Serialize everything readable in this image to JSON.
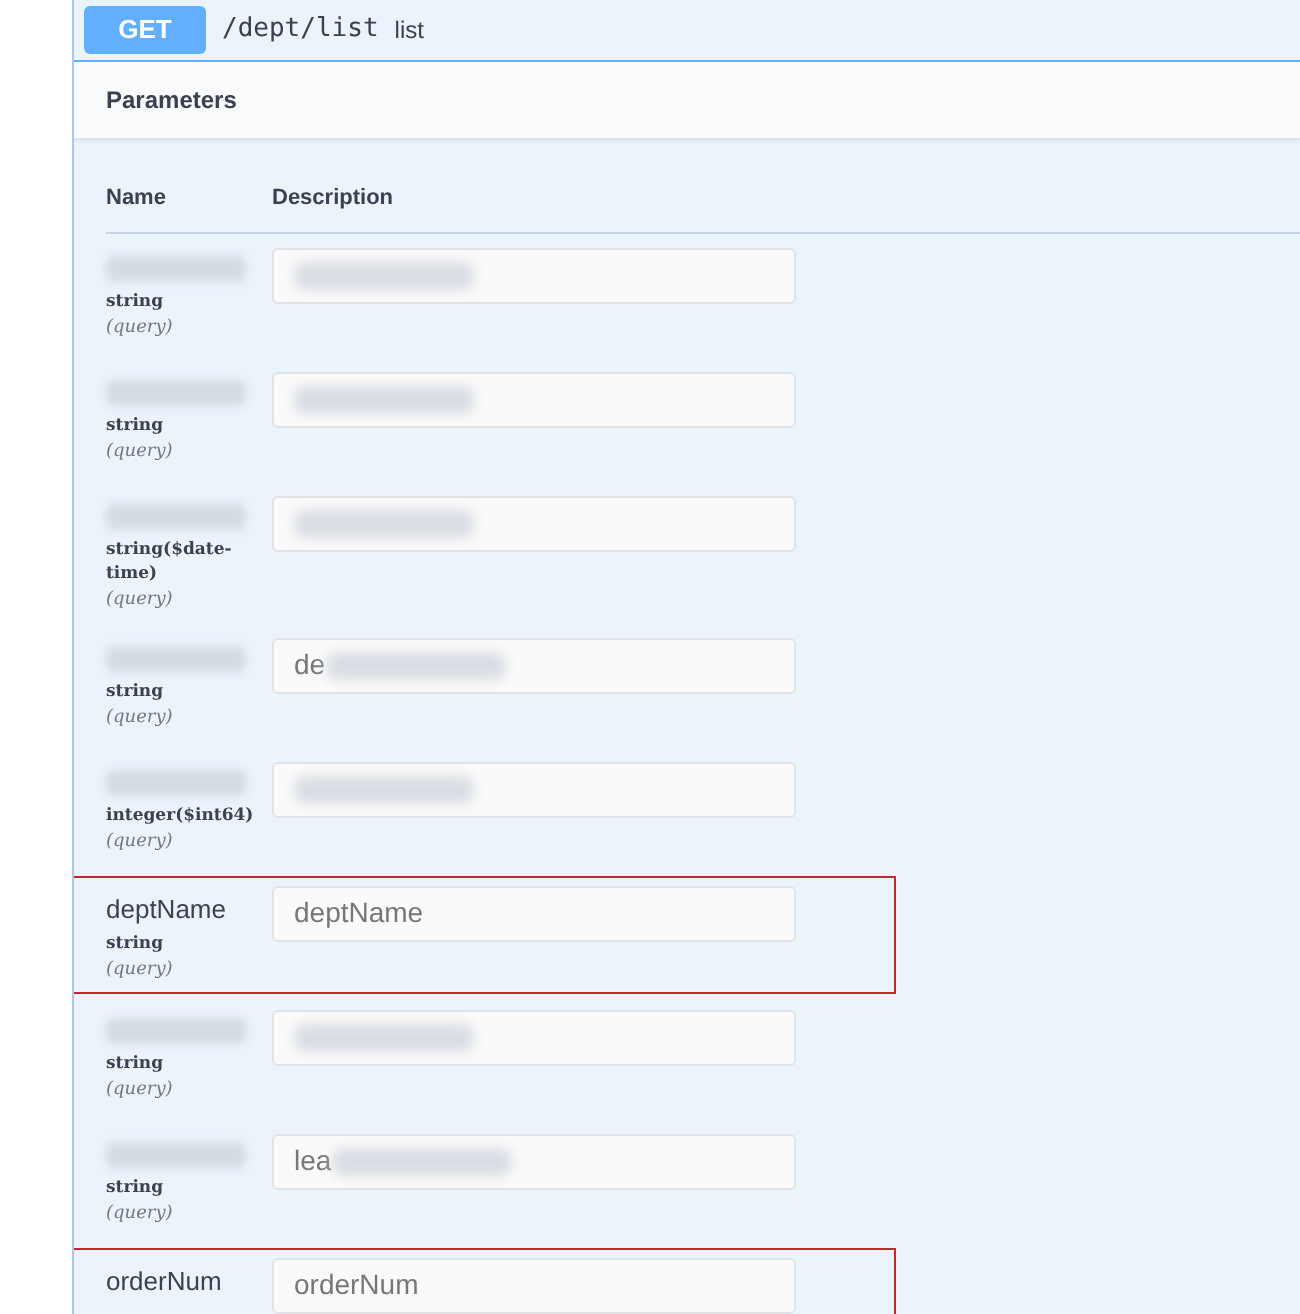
{
  "operation": {
    "method": "GET",
    "path": "/dept/list",
    "summary": "list"
  },
  "section_title": "Parameters",
  "columns": [
    "Name",
    "Description"
  ],
  "parameters": [
    {
      "name_redacted": true,
      "type": "string",
      "location": "(query)",
      "value_redacted": true,
      "highlighted": false
    },
    {
      "name_redacted": true,
      "type": "string",
      "location": "(query)",
      "value_redacted": true,
      "highlighted": false
    },
    {
      "name_redacted": true,
      "type": "string($date-time)",
      "location": "(query)",
      "value_redacted": true,
      "highlighted": false
    },
    {
      "name_redacted": true,
      "type": "string",
      "location": "(query)",
      "placeholder": "de",
      "value_redacted": true,
      "highlighted": false
    },
    {
      "name_redacted": true,
      "type": "integer($int64)",
      "location": "(query)",
      "value_redacted": true,
      "highlighted": false
    },
    {
      "name": "deptName",
      "type": "string",
      "location": "(query)",
      "placeholder": "deptName",
      "highlighted": true
    },
    {
      "name_redacted": true,
      "type": "string",
      "location": "(query)",
      "value_redacted": true,
      "highlighted": false
    },
    {
      "name_redacted": true,
      "type": "string",
      "location": "(query)",
      "placeholder": "lea",
      "value_redacted": true,
      "highlighted": false
    },
    {
      "name": "orderNum",
      "placeholder": "orderNum",
      "highlighted": true
    }
  ]
}
